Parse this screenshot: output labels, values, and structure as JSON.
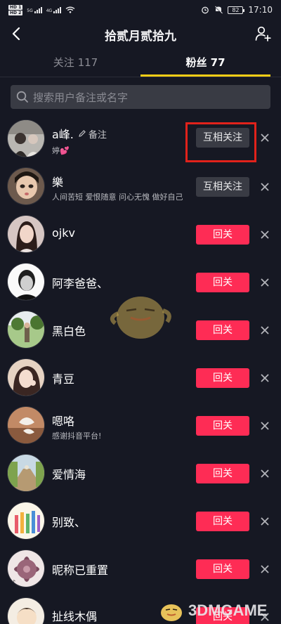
{
  "status_bar": {
    "hd1": "HD 1",
    "hd2": "HD 2",
    "net1": "5G",
    "net2": "4G",
    "battery": "82",
    "time": "17:10"
  },
  "header": {
    "title": "拾贰月贰拾九"
  },
  "tabs": [
    {
      "label": "关注 117",
      "active": false
    },
    {
      "label": "粉丝 77",
      "active": true
    }
  ],
  "search": {
    "placeholder": "搜索用户备注或名字"
  },
  "fans": [
    {
      "name": "a峰.",
      "note": "备注",
      "subtitle": "婷💕",
      "button": "互相关注",
      "button_style": "mutual"
    },
    {
      "name": "樂",
      "subtitle": "人间苦短 爱恨随意 问心无愧 做好自己",
      "button": "互相关注",
      "button_style": "mutual"
    },
    {
      "name": "ojkv",
      "button": "回关",
      "button_style": "follow"
    },
    {
      "name": "阿李爸爸、",
      "button": "回关",
      "button_style": "follow"
    },
    {
      "name": "黑白色",
      "button": "回关",
      "button_style": "follow"
    },
    {
      "name": "青豆",
      "button": "回关",
      "button_style": "follow"
    },
    {
      "name": "嗯咯",
      "subtitle": "感谢抖音平台!",
      "button": "回关",
      "button_style": "follow"
    },
    {
      "name": "爱情海",
      "button": "回关",
      "button_style": "follow"
    },
    {
      "name": "别致、",
      "button": "回关",
      "button_style": "follow"
    },
    {
      "name": "昵称已重置",
      "button": "回关",
      "button_style": "follow"
    },
    {
      "name": "扯线木偶",
      "button": "回关",
      "button_style": "follow"
    }
  ],
  "watermark": {
    "text": "3DMGAME"
  },
  "colors": {
    "accent_pink": "#fe2c55",
    "tab_yellow": "#face15",
    "background": "#161823",
    "highlight_red": "#e1221b"
  }
}
